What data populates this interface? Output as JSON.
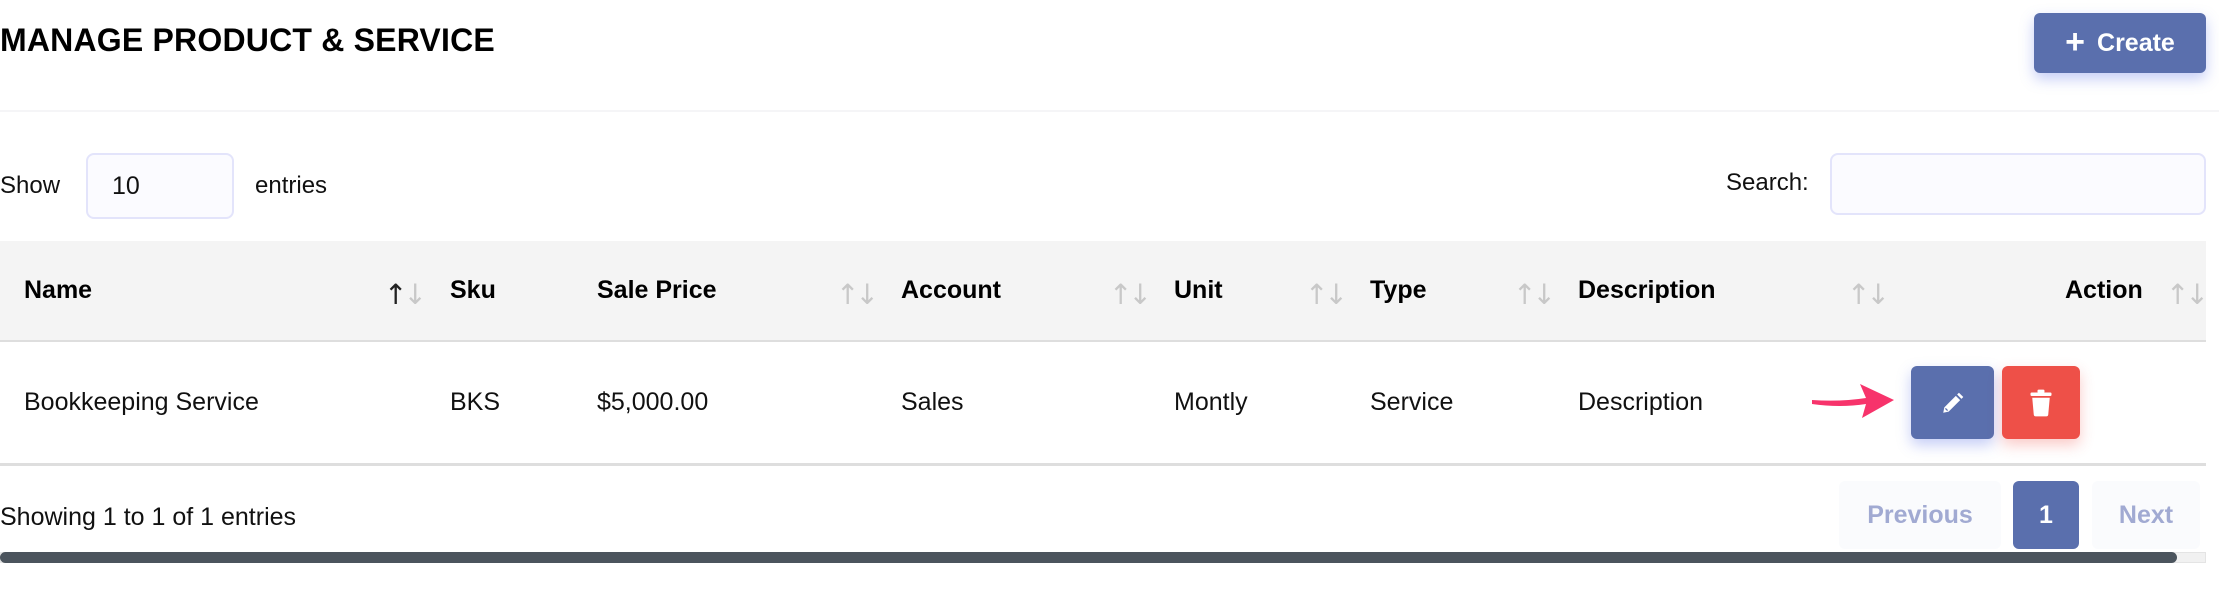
{
  "page": {
    "title": "MANAGE PRODUCT & SERVICE",
    "create_button": {
      "icon": "plus-icon",
      "label": "Create"
    },
    "accent_color": "#5a6fad",
    "danger_color": "#ee5048"
  },
  "table_controls": {
    "show_label": "Show",
    "page_length": "10",
    "entries_label": "entries",
    "search_label": "Search:",
    "search_value": ""
  },
  "table": {
    "columns": [
      {
        "label": "Name",
        "sort": "ascending"
      },
      {
        "label": "Sku",
        "sort": "none"
      },
      {
        "label": "Sale Price",
        "sort": "both"
      },
      {
        "label": "Account",
        "sort": "both"
      },
      {
        "label": "Unit",
        "sort": "both"
      },
      {
        "label": "Type",
        "sort": "both"
      },
      {
        "label": "Description",
        "sort": "both"
      },
      {
        "label": "Action",
        "sort": "both"
      }
    ],
    "rows": [
      {
        "name": "Bookkeeping Service",
        "sku": "BKS",
        "sale_price": "$5,000.00",
        "account": "Sales",
        "unit": "Montly",
        "type": "Service",
        "description": "Description",
        "actions": [
          {
            "icon": "pencil-icon",
            "label": "Edit"
          },
          {
            "icon": "trash-icon",
            "label": "Delete"
          }
        ]
      }
    ]
  },
  "footer": {
    "info": "Showing 1 to 1 of 1 entries",
    "pagination": {
      "previous": "Previous",
      "current_page": "1",
      "next": "Next"
    }
  },
  "sort_glyphs": {
    "up": "↑",
    "down": "↓"
  }
}
